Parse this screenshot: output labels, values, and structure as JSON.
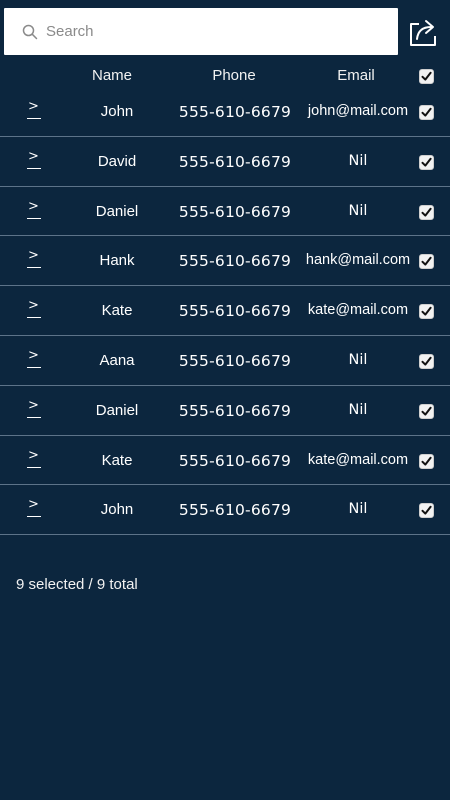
{
  "search": {
    "placeholder": "Search",
    "value": ""
  },
  "header": {
    "name": "Name",
    "phone": "Phone",
    "email": "Email",
    "select_all_checked": true
  },
  "rows": [
    {
      "name": "John",
      "phone": "555-610-6679",
      "email": "john@mail.com",
      "checked": true
    },
    {
      "name": "David",
      "phone": "555-610-6679",
      "email": "Nil",
      "checked": true
    },
    {
      "name": "Daniel",
      "phone": "555-610-6679",
      "email": "Nil",
      "checked": true
    },
    {
      "name": "Hank",
      "phone": "555-610-6679",
      "email": "hank@mail.com",
      "checked": true
    },
    {
      "name": "Kate",
      "phone": "555-610-6679",
      "email": "kate@mail.com",
      "checked": true
    },
    {
      "name": "Aana",
      "phone": "555-610-6679",
      "email": "Nil",
      "checked": true
    },
    {
      "name": "Daniel",
      "phone": "555-610-6679",
      "email": "Nil",
      "checked": true
    },
    {
      "name": "Kate",
      "phone": "555-610-6679",
      "email": "kate@mail.com",
      "checked": true
    },
    {
      "name": "John",
      "phone": "555-610-6679",
      "email": "Nil",
      "checked": true
    }
  ],
  "footer": {
    "selection_summary": "9 selected / 9 total"
  },
  "icons": {
    "search": "search-icon",
    "share": "share-icon",
    "row_expand": "chevron-right-icon",
    "checkbox": "checkmark-icon"
  },
  "colors": {
    "background": "#0c263e",
    "divider": "#5d7389",
    "text": "#ffffff"
  }
}
